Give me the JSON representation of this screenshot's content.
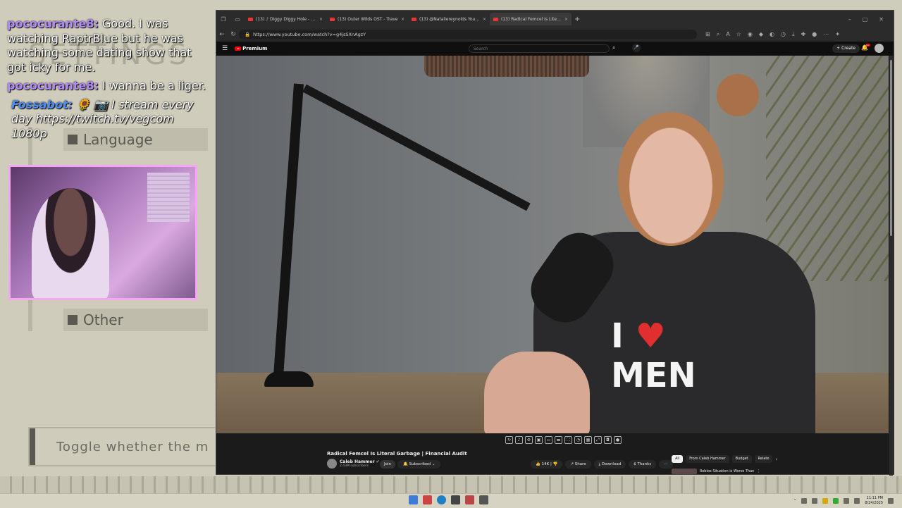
{
  "chat": {
    "messages": [
      {
        "user": "pococurante8:",
        "text": "Good. I was watching RaptrBlue but he was watching some dating show that got icky for me."
      },
      {
        "user": "pococurante8:",
        "text": "I wanna be a liger."
      }
    ],
    "bot": {
      "user": "Fossabot:",
      "emotes": "🌻 📷",
      "text": "I stream every day https://twitch.tv/vegcom 1080p"
    }
  },
  "overlay": {
    "settings_ghost": "SETTINGS",
    "language_label": "Language",
    "other_label": "Other",
    "toggle_text": "Toggle whether the m"
  },
  "browser": {
    "tabs": [
      {
        "label": "(13) ♪ Diggy Diggy Hole - YouTub",
        "active": false
      },
      {
        "label": "(13) Outer Wilds OST - Trave",
        "active": false
      },
      {
        "label": "(13) @Nataliereynolds YouTube",
        "active": false
      },
      {
        "label": "(13) Radical Femcel Is Literal",
        "active": true
      }
    ],
    "url": "https://www.youtube.com/watch?v=g4jsSXnAgzY"
  },
  "youtube": {
    "logo_text": "Premium",
    "search_placeholder": "Search",
    "create_label": "Create",
    "notif_count": "9+",
    "video_title": "Radical Femcel Is Literal Garbage | Financial Audit",
    "channel_name": "Caleb Hammer",
    "subscribers": "2.43M subscribers",
    "join_label": "Join",
    "subscribed_label": "Subscribed",
    "likes": "14K",
    "share_label": "Share",
    "download_label": "Download",
    "thanks_label": "Thanks",
    "chips": [
      "All",
      "From Caleb Hammer",
      "Budget",
      "Relate"
    ],
    "recommended_title": "Roblox Situation is Worse Than",
    "shirt_text_i": "I",
    "shirt_text_men": "MEN"
  },
  "taskbar": {
    "time": "11:11 PM",
    "date": "8/24/2025"
  },
  "colors": {
    "chat_user": "#b58cff",
    "bot_user": "#4f8ff7",
    "cam_border": "#f3a7f0",
    "yt_red": "#ff0000"
  }
}
